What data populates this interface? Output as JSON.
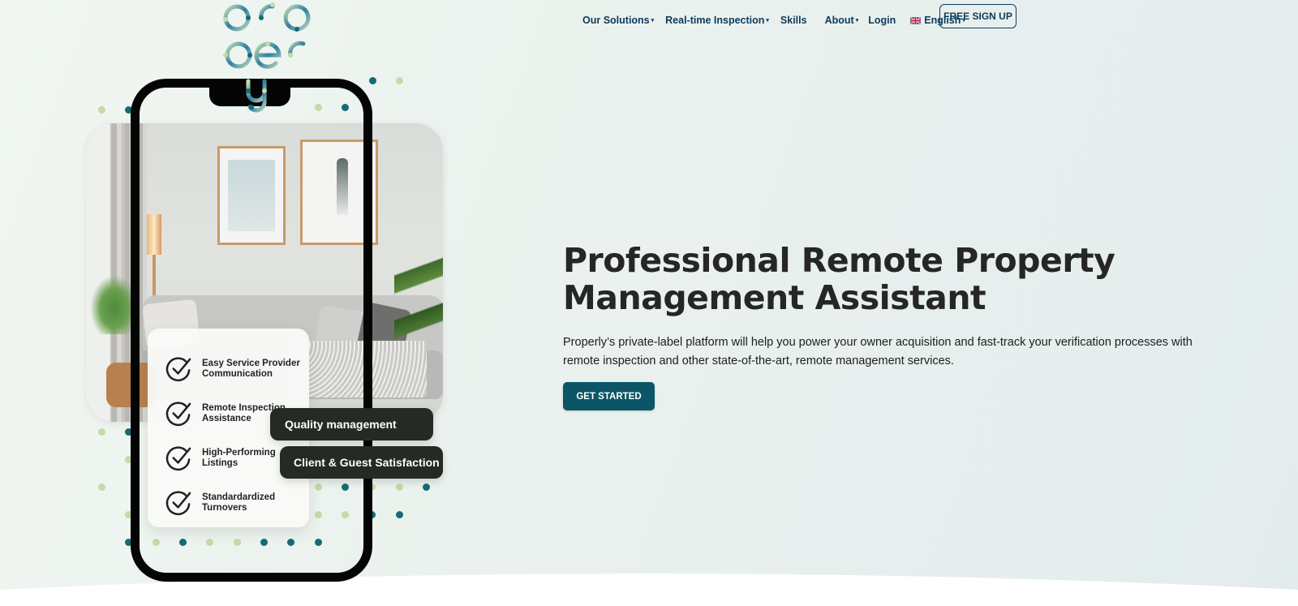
{
  "brand": {
    "logo_alt": "properly",
    "logo_lines": [
      "pro",
      "per",
      "ly"
    ]
  },
  "nav": {
    "items": [
      {
        "label": "Our Solutions",
        "has_dropdown": true
      },
      {
        "label": "Real-time Inspection",
        "has_dropdown": true
      },
      {
        "label": "Skills",
        "has_dropdown": false
      },
      {
        "label": "About",
        "has_dropdown": true
      },
      {
        "label": "Login",
        "has_dropdown": false
      }
    ],
    "language": {
      "label": "English",
      "flag_icon": "uk-flag-icon",
      "has_dropdown": true
    },
    "signup_label": "FREE SIGN UP",
    "caret_glyph": "▾"
  },
  "illustration": {
    "features": [
      {
        "icon": "check-circle-icon",
        "label": "Easy Service Provider Communication"
      },
      {
        "icon": "check-circle-icon",
        "label": "Remote Inspection Assistance"
      },
      {
        "icon": "check-circle-icon",
        "label": "High-Performing Listings"
      },
      {
        "icon": "check-circle-icon",
        "label": "Standardardized Turnovers"
      }
    ],
    "pills": [
      "Quality management",
      "Client & Guest Satisfaction"
    ]
  },
  "hero": {
    "title": "Professional Remote Property Management Assistant",
    "description": "Properly’s private-label platform will help you power your owner acquisition and fast-track your verification processes with remote inspection and other state-of-the-art, remote management services.",
    "cta_label": "GET STARTED"
  },
  "colors": {
    "brand_teal": "#0c5566",
    "nav_text": "#0d3b5a",
    "dot_teal": "#156a78",
    "dot_green": "#c3dba6",
    "pill_bg": "#252a24",
    "headline": "#262626"
  }
}
